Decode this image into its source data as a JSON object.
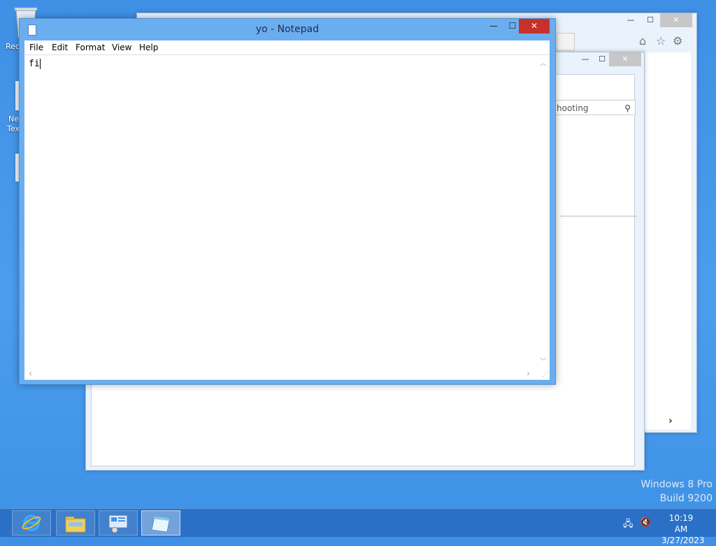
{
  "desktop": {
    "icons": [
      {
        "label": "Rec",
        "name": "recycle-bin"
      },
      {
        "label": "Ne",
        "label2": "Tex",
        "name": "new-text-document"
      }
    ]
  },
  "background_window": {
    "controls": {
      "minimize": "—",
      "maximize": "☐",
      "close": "✕"
    },
    "tools": {
      "home": "⌂",
      "favorites": "☆",
      "settings": "⚙"
    }
  },
  "middle_window": {
    "controls": {
      "minimize": "—",
      "maximize": "☐",
      "close": "✕"
    },
    "search": {
      "placeholder": "hooting",
      "icon": "search-icon"
    }
  },
  "notepad": {
    "title": "yo - Notepad",
    "menu": [
      "File",
      "Edit",
      "Format",
      "View",
      "Help"
    ],
    "content": "fi",
    "controls": {
      "minimize": "—",
      "maximize": "☐",
      "close": "✕"
    }
  },
  "watermark": {
    "line1": "Windows 8 Pro",
    "line2": "Build 9200"
  },
  "taskbar": {
    "apps": [
      {
        "name": "internet-explorer",
        "icon": "ie-icon",
        "active": false
      },
      {
        "name": "file-explorer",
        "icon": "folder-icon",
        "active": false
      },
      {
        "name": "control-panel",
        "icon": "control-panel-icon",
        "active": false
      },
      {
        "name": "notepad",
        "icon": "notepad-icon",
        "active": true
      }
    ],
    "clock": {
      "time": "10:19 AM",
      "date": "3/27/2023"
    }
  }
}
